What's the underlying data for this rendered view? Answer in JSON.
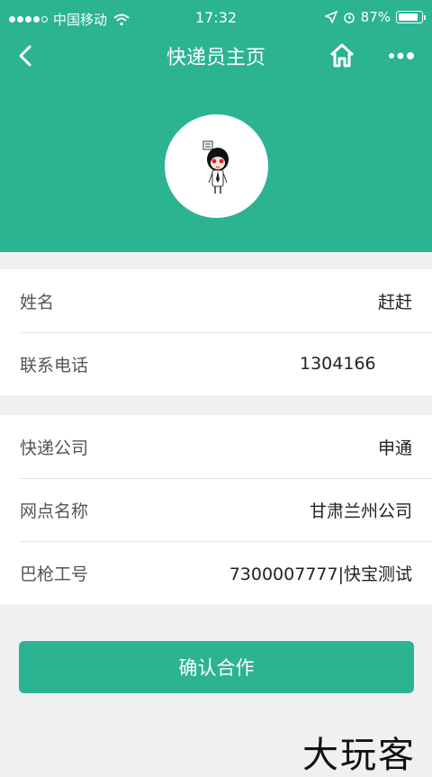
{
  "status_bar": {
    "carrier": "中国移动",
    "time": "17:32",
    "battery_percent": "87%",
    "battery_level": 0.87
  },
  "navbar": {
    "title": "快递员主页",
    "icons": [
      "back-icon",
      "home-icon",
      "more-icon"
    ]
  },
  "profile": {
    "avatar_icon": "cartoon-avatar-icon"
  },
  "info_card_1": {
    "rows": [
      {
        "label": "姓名",
        "value": "赶赶"
      },
      {
        "label": "联系电话",
        "value": "1304166"
      }
    ]
  },
  "info_card_2": {
    "rows": [
      {
        "label": "快递公司",
        "value": "申通"
      },
      {
        "label": "网点名称",
        "value": "甘肃兰州公司"
      },
      {
        "label": "巴枪工号",
        "value": "7300007777|快宝测试"
      }
    ]
  },
  "confirm_button": {
    "label": "确认合作"
  },
  "watermark": "大玩客",
  "colors": {
    "primary": "#2bb392",
    "background": "#f0f0f0"
  }
}
